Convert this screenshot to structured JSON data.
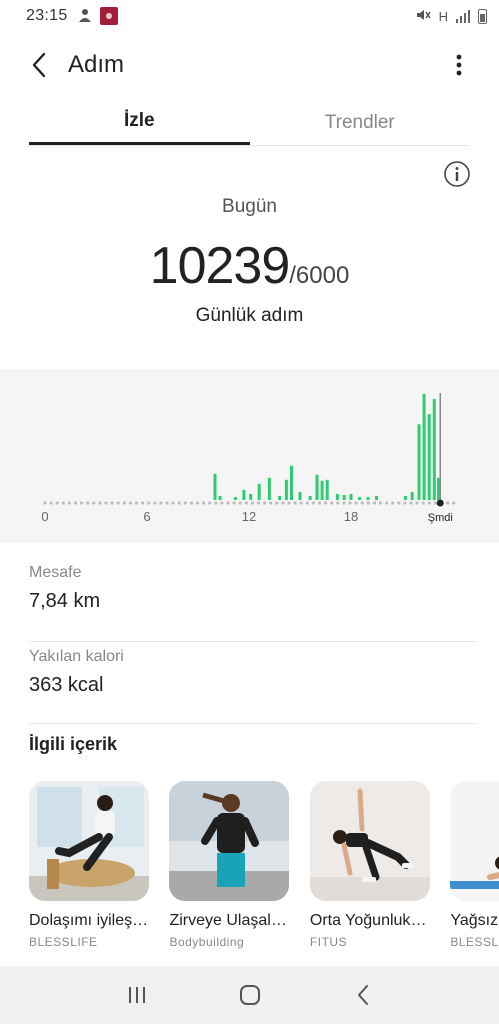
{
  "status_bar": {
    "time": "23:15",
    "icons": [
      "person-icon",
      "app-notification-icon",
      "mute-icon",
      "network-h-icon",
      "signal-icon",
      "battery-icon"
    ],
    "network_label": "H"
  },
  "header": {
    "title": "Adım",
    "back_icon": "chevron-left-icon",
    "more_icon": "more-vertical-icon"
  },
  "tabs": [
    {
      "label": "İzle",
      "active": true
    },
    {
      "label": "Trendler",
      "active": false
    }
  ],
  "summary": {
    "period": "Bugün",
    "steps": "10239",
    "goal": "/6000",
    "steps_label": "Günlük adım"
  },
  "chart_data": {
    "type": "bar",
    "x_tick_labels": [
      "0",
      "6",
      "12",
      "18",
      "Şmdi"
    ],
    "x_range": [
      0,
      24
    ],
    "color": "#2ecc71",
    "now_hour": 23.25,
    "bars": [
      {
        "hour": 10.0,
        "value": 26
      },
      {
        "hour": 10.3,
        "value": 4
      },
      {
        "hour": 11.2,
        "value": 3
      },
      {
        "hour": 11.7,
        "value": 10
      },
      {
        "hour": 12.1,
        "value": 6
      },
      {
        "hour": 12.6,
        "value": 16
      },
      {
        "hour": 13.2,
        "value": 22
      },
      {
        "hour": 13.8,
        "value": 4
      },
      {
        "hour": 14.2,
        "value": 20
      },
      {
        "hour": 14.5,
        "value": 34
      },
      {
        "hour": 15.0,
        "value": 8
      },
      {
        "hour": 15.6,
        "value": 4
      },
      {
        "hour": 16.0,
        "value": 25
      },
      {
        "hour": 16.3,
        "value": 19
      },
      {
        "hour": 16.6,
        "value": 20
      },
      {
        "hour": 17.2,
        "value": 6
      },
      {
        "hour": 17.6,
        "value": 5
      },
      {
        "hour": 18.0,
        "value": 6
      },
      {
        "hour": 18.5,
        "value": 3
      },
      {
        "hour": 19.0,
        "value": 3
      },
      {
        "hour": 19.5,
        "value": 4
      },
      {
        "hour": 21.2,
        "value": 4
      },
      {
        "hour": 21.6,
        "value": 8
      },
      {
        "hour": 22.0,
        "value": 75
      },
      {
        "hour": 22.3,
        "value": 105
      },
      {
        "hour": 22.6,
        "value": 85
      },
      {
        "hour": 22.9,
        "value": 100
      },
      {
        "hour": 23.15,
        "value": 22
      }
    ]
  },
  "stats": [
    {
      "label": "Mesafe",
      "value": "7,84 km"
    },
    {
      "label": "Yakılan kalori",
      "value": "363 kcal"
    }
  ],
  "related": {
    "title": "İlgili içerik",
    "cards": [
      {
        "title": "Dolaşımı iyileştirmek iç…",
        "source": "BLESSLIFE",
        "theme": "pilates"
      },
      {
        "title": "Zirveye Ulaşalım: Kar…",
        "source": "Bodybuilding",
        "theme": "running"
      },
      {
        "title": "Orta Yoğunluklu T…",
        "source": "FITUS",
        "theme": "yoga"
      },
      {
        "title": "Yağsız B Vücuda",
        "source": "BLESSLIFE",
        "theme": "mat"
      }
    ]
  },
  "nav": {
    "recent_icon": "recent-apps-icon",
    "home_icon": "home-icon",
    "back_icon": "back-icon"
  }
}
